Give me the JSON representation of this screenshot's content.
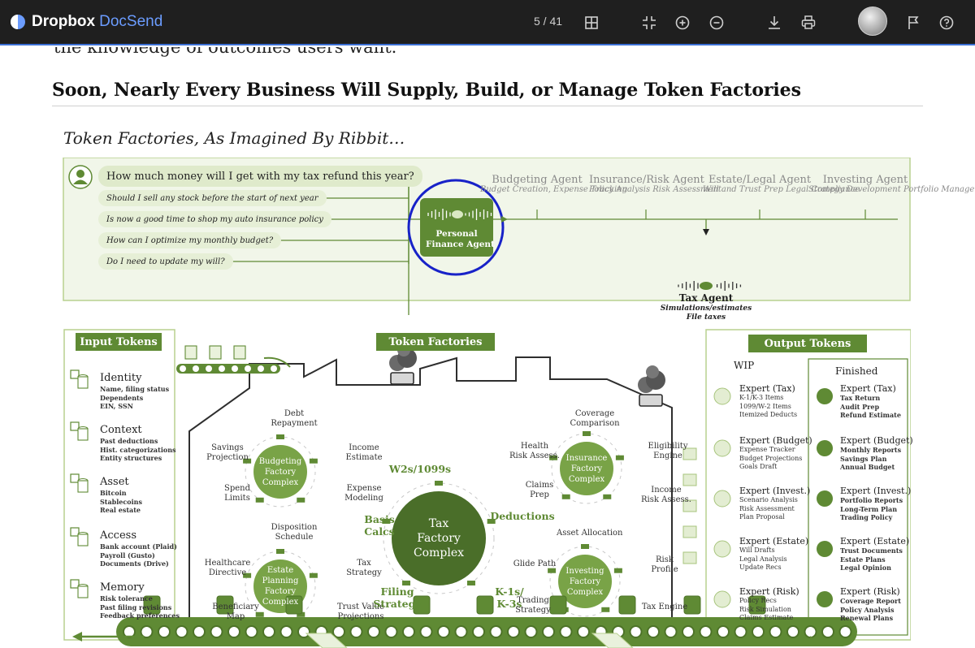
{
  "app": {
    "brand": "Dropbox",
    "product": "DocSend",
    "page_counter": "5 / 41",
    "accent_color": "#3b6fd4"
  },
  "toolbar": {
    "icons": [
      "grid-view-icon",
      "exit-fullscreen-icon",
      "zoom-in-icon",
      "zoom-out-icon",
      "download-icon",
      "print-icon",
      "avatar",
      "flag-icon",
      "help-icon"
    ]
  },
  "document": {
    "previous_line": "the knowledge of outcomes users want.",
    "heading": "Soon, Nearly Every Business Will Supply, Build, or Manage Token Factories",
    "subheading": "Token Factories, As Imagined By Ribbit…"
  },
  "infographic": {
    "theme_color": "#5f8a34",
    "questions": [
      "How much money will I get with my tax refund this year?",
      "Should I sell any stock before the start of next year",
      "Is now a good time to shop my auto insurance policy",
      "How can I optimize my monthly budget?",
      "Do I need to update my will?"
    ],
    "personal_agent": "Personal\nFinance Agent",
    "agents": [
      {
        "name": "Budgeting Agent",
        "desc": "Budget Creation,\nExpense Tracking"
      },
      {
        "name": "Insurance/Risk Agent",
        "desc": "Policy Analysis\nRisk Assessment"
      },
      {
        "name": "Estate/Legal Agent",
        "desc": "Will and Trust Prep\nLegal Compliance"
      },
      {
        "name": "Investing Agent",
        "desc": "Strategy Development\nPortfolio Management"
      }
    ],
    "tax_agent": {
      "name": "Tax Agent",
      "desc1": "Simulations/estimates",
      "desc2": "File taxes"
    },
    "input_tokens": {
      "title": "Input Tokens",
      "items": [
        {
          "title": "Identity",
          "detail": "Name, filing status\nDependents\nEIN, SSN"
        },
        {
          "title": "Context",
          "detail": "Past deductions\nHist. categorizations\nEntity structures"
        },
        {
          "title": "Asset",
          "detail": "Bitcoin\nStablecoins\nReal estate"
        },
        {
          "title": "Access",
          "detail": "Bank account (Plaid)\nPayroll (Gusto)\nDocuments (Drive)"
        },
        {
          "title": "Memory",
          "detail": "Risk tolerance\nPast filing revisions\nFeedback preferences"
        }
      ]
    },
    "token_factories": {
      "title": "Token Factories",
      "budgeting": {
        "complex": "Budgeting\nFactory\nComplex",
        "labels": [
          "Debt\nRepayment",
          "Income\nEstimate",
          "Expense\nModeling",
          "Spend\nLimits",
          "Savings\nProjection"
        ]
      },
      "estate": {
        "complex": "Estate\nPlanning\nFactory\nComplex",
        "labels": [
          "Disposition\nSchedule",
          "Tax\nStrategy",
          "Trust Value\nProjections",
          "Beneficiary\nMap",
          "Healthcare\nDirective"
        ]
      },
      "tax": {
        "complex": "Tax\nFactory\nComplex",
        "labels": [
          "W2s/1099s",
          "Deductions",
          "K-1s/\nK-3s",
          "Filing\nStrategy",
          "Basis\nCalcs"
        ]
      },
      "insurance": {
        "complex": "Insurance\nFactory\nComplex",
        "labels": [
          "Coverage\nComparison",
          "Eligibility\nEngine",
          "Income\nRisk Assess.",
          "Claims\nPrep",
          "Health\nRisk Assess."
        ]
      },
      "investing": {
        "complex": "Investing\nFactory\nComplex",
        "labels": [
          "Asset Allocation",
          "Risk\nProfile",
          "Tax Engine",
          "Trading\nStrategy",
          "Glide Path"
        ]
      }
    },
    "output_tokens": {
      "title": "Output Tokens",
      "wip_label": "WIP",
      "finished_label": "Finished",
      "wip": [
        {
          "title": "Expert (Tax)",
          "detail": "K-1/K-3 Items\n1099/W-2 Items\nItemized Deducts"
        },
        {
          "title": "Expert (Budget)",
          "detail": "Expense Tracker\nBudget Projections\nGoals Draft"
        },
        {
          "title": "Expert (Invest.)",
          "detail": "Scenario Analysis\nRisk Assessment\nPlan Proposal"
        },
        {
          "title": "Expert (Estate)",
          "detail": "Will Drafts\nLegal Analysis\nUpdate Recs"
        },
        {
          "title": "Expert (Risk)",
          "detail": "Policy Recs\nRisk Simulation\nClaims Estimate"
        }
      ],
      "finished": [
        {
          "title": "Expert (Tax)",
          "detail": "Tax Return\nAudit Prep\nRefund Estimate"
        },
        {
          "title": "Expert (Budget)",
          "detail": "Monthly Reports\nSavings Plan\nAnnual Budget"
        },
        {
          "title": "Expert (Invest.)",
          "detail": "Portfolio Reports\nLong-Term Plan\nTrading Policy"
        },
        {
          "title": "Expert (Estate)",
          "detail": "Trust Documents\nEstate Plans\nLegal Opinion"
        },
        {
          "title": "Expert (Risk)",
          "detail": "Coverage Report\nPolicy Analysis\nRenewal Plans"
        }
      ]
    }
  }
}
